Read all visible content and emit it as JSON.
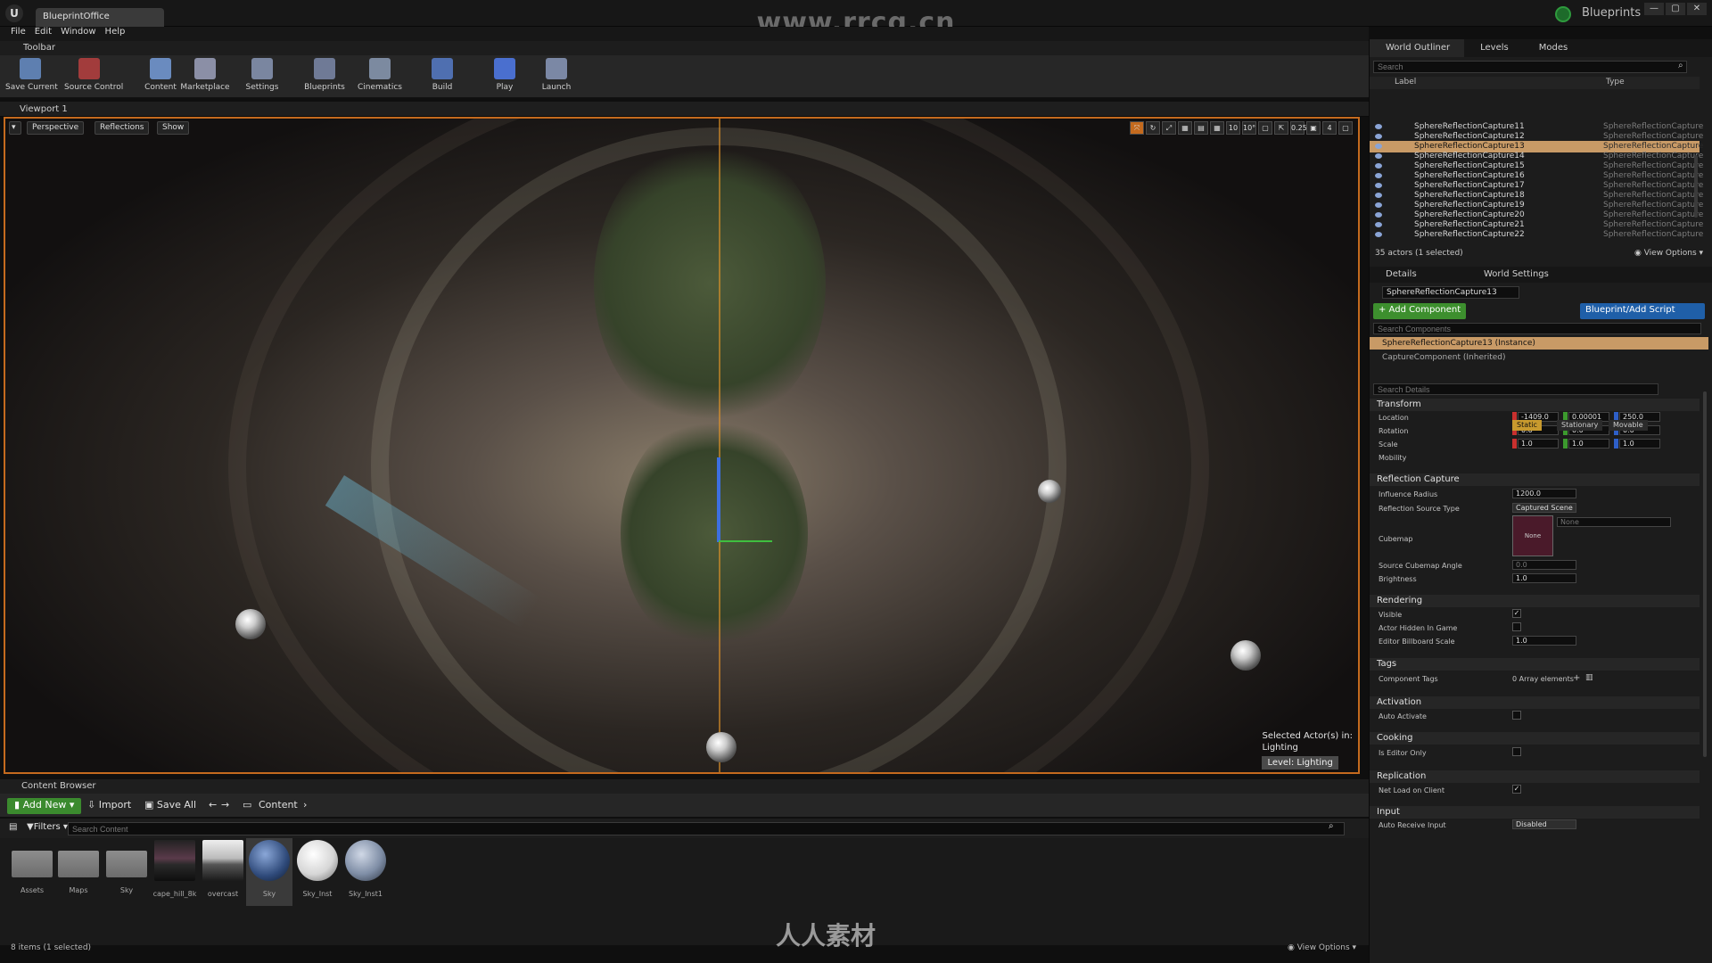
{
  "titlebar": {
    "doc_tab": "BlueprintOffice",
    "watermark": "www.rrcg.cn",
    "blueprints_label": "Blueprints",
    "win_buttons": [
      "—",
      "▢",
      "✕"
    ]
  },
  "menu": [
    "File",
    "Edit",
    "Window",
    "Help"
  ],
  "toolbar": {
    "title": "Toolbar",
    "buttons": [
      {
        "label": "Save Current",
        "color": "#5e7fb0"
      },
      {
        "label": "Source Control",
        "color": "#a23c3c"
      },
      {
        "label": "Content",
        "color": "#6a8bbf"
      },
      {
        "label": "Marketplace",
        "color": "#8b8fa6"
      },
      {
        "label": "Settings",
        "color": "#7a86a0"
      },
      {
        "label": "Blueprints",
        "color": "#6f7a96"
      },
      {
        "label": "Cinematics",
        "color": "#7c8aa0"
      },
      {
        "label": "Build",
        "color": "#4f6fb0"
      },
      {
        "label": "Play",
        "color": "#4a6fcf"
      },
      {
        "label": "Launch",
        "color": "#7b88a5"
      }
    ]
  },
  "viewport": {
    "tab": "Viewport 1",
    "perspective": "Perspective",
    "reflections": "Reflections",
    "show": "Show",
    "right_icons": [
      "⤧",
      "↻",
      "⤢",
      "▦",
      "▤",
      "▦",
      "10",
      "10°",
      "▢",
      "⇱",
      "0.25",
      "▣",
      "4",
      "▢"
    ],
    "selected_actors": "Selected Actor(s) in:",
    "selected_level": "Lighting",
    "level_label": "Level:  Lighting"
  },
  "content_browser": {
    "title": "Content Browser",
    "add_new": "Add New",
    "import": "Import",
    "save_all": "Save All",
    "path": "Content",
    "filters": "Filters",
    "search_placeholder": "Search Content",
    "assets": [
      {
        "name": "Assets",
        "kind": "folder"
      },
      {
        "name": "Maps",
        "kind": "folder"
      },
      {
        "name": "Sky",
        "kind": "folder"
      },
      {
        "name": "cape_hill_8k",
        "kind": "hdr1"
      },
      {
        "name": "overcast",
        "kind": "hdr2"
      },
      {
        "name": "Sky",
        "kind": "sphere-blue"
      },
      {
        "name": "Sky_Inst",
        "kind": "sphere-white"
      },
      {
        "name": "Sky_Inst1",
        "kind": "sphere-grey"
      }
    ],
    "status": "8 items (1 selected)",
    "view_options": "View Options",
    "bottom_logo": "人人素材"
  },
  "outliner": {
    "tabs": [
      "World Outliner",
      "Levels",
      "Modes"
    ],
    "search_placeholder": "Search",
    "col_label": "Label",
    "col_type": "Type",
    "rows": [
      {
        "name": "SphereReflectionCapture11",
        "type": "SphereReflectionCapture",
        "selected": false
      },
      {
        "name": "SphereReflectionCapture12",
        "type": "SphereReflectionCapture",
        "selected": false
      },
      {
        "name": "SphereReflectionCapture13",
        "type": "SphereReflectionCapture",
        "selected": true
      },
      {
        "name": "SphereReflectionCapture14",
        "type": "SphereReflectionCapture",
        "selected": false
      },
      {
        "name": "SphereReflectionCapture15",
        "type": "SphereReflectionCapture",
        "selected": false
      },
      {
        "name": "SphereReflectionCapture16",
        "type": "SphereReflectionCapture",
        "selected": false
      },
      {
        "name": "SphereReflectionCapture17",
        "type": "SphereReflectionCapture",
        "selected": false
      },
      {
        "name": "SphereReflectionCapture18",
        "type": "SphereReflectionCapture",
        "selected": false
      },
      {
        "name": "SphereReflectionCapture19",
        "type": "SphereReflectionCapture",
        "selected": false
      },
      {
        "name": "SphereReflectionCapture20",
        "type": "SphereReflectionCapture",
        "selected": false
      },
      {
        "name": "SphereReflectionCapture21",
        "type": "SphereReflectionCapture",
        "selected": false
      },
      {
        "name": "SphereReflectionCapture22",
        "type": "SphereReflectionCapture",
        "selected": false
      }
    ],
    "count": "35 actors (1 selected)",
    "view_options": "View Options"
  },
  "details": {
    "tabs": [
      "Details",
      "World Settings"
    ],
    "object_name": "SphereReflectionCapture13",
    "add_component": "+ Add Component",
    "blueprint_script": "Blueprint/Add Script",
    "search_components": "Search Components",
    "component_instance": "SphereReflectionCapture13 (Instance)",
    "component_inherited": "CaptureComponent (Inherited)",
    "search_details": "Search Details",
    "transform": {
      "title": "Transform",
      "location_label": "Location",
      "rotation_label": "Rotation",
      "scale_label": "Scale",
      "mobility_label": "Mobility",
      "location": [
        "-1409.0",
        "0.00001",
        "250.0"
      ],
      "rotation": [
        "0.0 °",
        "0.0 °",
        "0.0 °"
      ],
      "scale": [
        "1.0",
        "1.0",
        "1.0"
      ],
      "mobility": [
        "Static",
        "Stationary",
        "Movable"
      ]
    },
    "reflection": {
      "title": "Reflection Capture",
      "influence_label": "Influence Radius",
      "influence": "1200.0",
      "source_label": "Reflection Source Type",
      "source": "Captured Scene",
      "cubemap_label": "Cubemap",
      "cubemap_thumb": "None",
      "cubemap_value": "None",
      "angle_label": "Source Cubemap Angle",
      "angle": "0.0",
      "brightness_label": "Brightness",
      "brightness": "1.0"
    },
    "rendering": {
      "title": "Rendering",
      "visible_label": "Visible",
      "visible": true,
      "hidden_label": "Actor Hidden In Game",
      "hidden": false,
      "billboard_label": "Editor Billboard Scale",
      "billboard": "1.0"
    },
    "tags": {
      "title": "Tags",
      "component_label": "Component Tags",
      "component_value": "0 Array elements"
    },
    "activation": {
      "title": "Activation",
      "auto_label": "Auto Activate",
      "auto": false
    },
    "cooking": {
      "title": "Cooking",
      "editor_only_label": "Is Editor Only",
      "editor_only": false
    },
    "replication": {
      "title": "Replication",
      "net_label": "Net Load on Client",
      "net": true
    },
    "input": {
      "title": "Input",
      "auto_receive_label": "Auto Receive Input",
      "auto_receive": "Disabled"
    }
  }
}
